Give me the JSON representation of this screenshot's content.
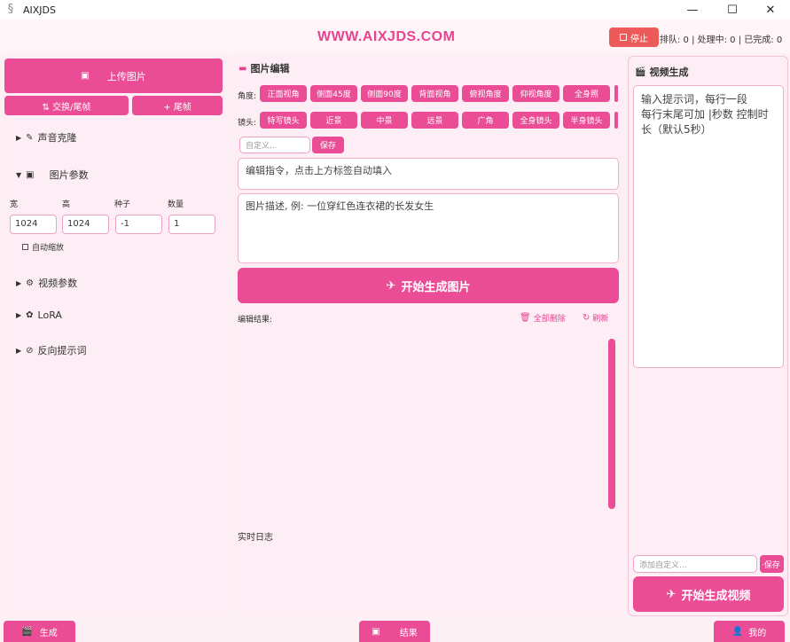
{
  "window": {
    "title": "AIXJDS",
    "min": "—",
    "max": "☐",
    "close": "✕"
  },
  "header": {
    "brand": "WWW.AIXJDS.COM",
    "stop_label": "停止",
    "status": "排队: 0 | 处理中: 0 | 已完成: 0"
  },
  "left": {
    "upload_label": "上传图片",
    "swap_label": "⇅ 交换/尾帧",
    "tail_label": "+ 尾帧",
    "voice_clone": "声音克隆",
    "image_params": "图片参数",
    "params": {
      "width_label": "宽",
      "height_label": "高",
      "seed_label": "种子",
      "count_label": "数量",
      "width": "1024",
      "height": "1024",
      "seed": "-1",
      "count": "1"
    },
    "auto_scale": "自动缩放",
    "video_params": "视频参数",
    "lora": "LoRA",
    "negative_prompt": "反向提示词"
  },
  "center": {
    "title": "图片编辑",
    "angle_label": "角度:",
    "angles": [
      "正面视角",
      "侧面45度",
      "侧面90度",
      "背面视角",
      "俯视角度",
      "仰视角度",
      "全身照"
    ],
    "lens_label": "镜头:",
    "lenses": [
      "特写镜头",
      "近景",
      "中景",
      "远景",
      "广角",
      "全身镜头",
      "半身镜头"
    ],
    "custom_placeholder": "自定义...",
    "save_label": "保存",
    "edit_instruction": "编辑指令，点击上方标签自动填入",
    "image_desc": "图片描述, 例: 一位穿红色连衣裙的长发女生",
    "generate_label": "开始生成图片",
    "result_label": "编辑结果:",
    "delete_all": "全部删除",
    "refresh": "刷新",
    "log_label": "实时日志"
  },
  "right": {
    "title": "视频生成",
    "prompt_text": "输入提示词，每行一段\n每行末尾可加 |秒数 控制时长（默认5秒）",
    "custom_placeholder": "添加自定义...",
    "save_label": "·保存",
    "generate_label": "开始生成视频"
  },
  "bottom": {
    "generate_tab": "生成",
    "results_tab": "结果",
    "mine_tab": "我的"
  },
  "colors": {
    "accent": "#ea4d96",
    "brand": "#e64490",
    "stop": "#ec5a5a",
    "panel": "#fceef4"
  }
}
